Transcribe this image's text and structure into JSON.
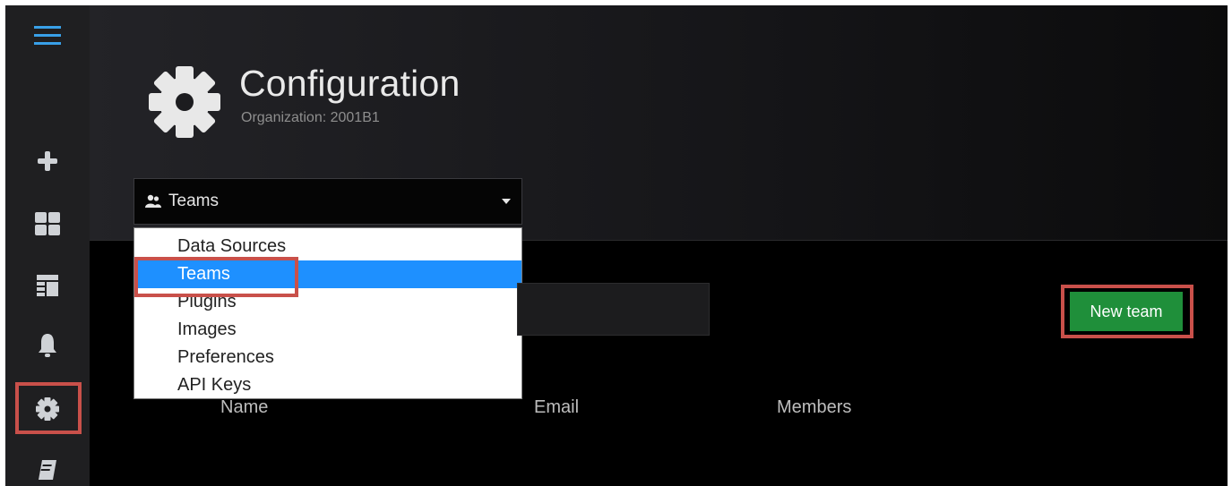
{
  "header": {
    "title": "Configuration",
    "subtitle": "Organization: 2001B1",
    "icon": "gear-icon"
  },
  "sidebar": {
    "items": [
      {
        "icon": "hamburger-menu-icon"
      },
      {
        "icon": "plus-icon"
      },
      {
        "icon": "dashboard-grid-icon"
      },
      {
        "icon": "layout-icon"
      },
      {
        "icon": "bell-icon"
      },
      {
        "icon": "gear-icon",
        "active": true
      },
      {
        "icon": "book-icon"
      }
    ]
  },
  "config_select": {
    "selected": "Teams",
    "options": [
      "Data Sources",
      "Teams",
      "Plugins",
      "Images",
      "Preferences",
      "API Keys"
    ]
  },
  "actions": {
    "new_team": "New team"
  },
  "table": {
    "columns": [
      "Name",
      "Email",
      "Members"
    ]
  },
  "colors": {
    "accent_green": "#1f8f3a",
    "highlight_red": "#c9504a",
    "selection_blue": "#1e90ff",
    "sidebar_icon": "#cfd2d6",
    "menu_icon_blue": "#39a0e8"
  }
}
